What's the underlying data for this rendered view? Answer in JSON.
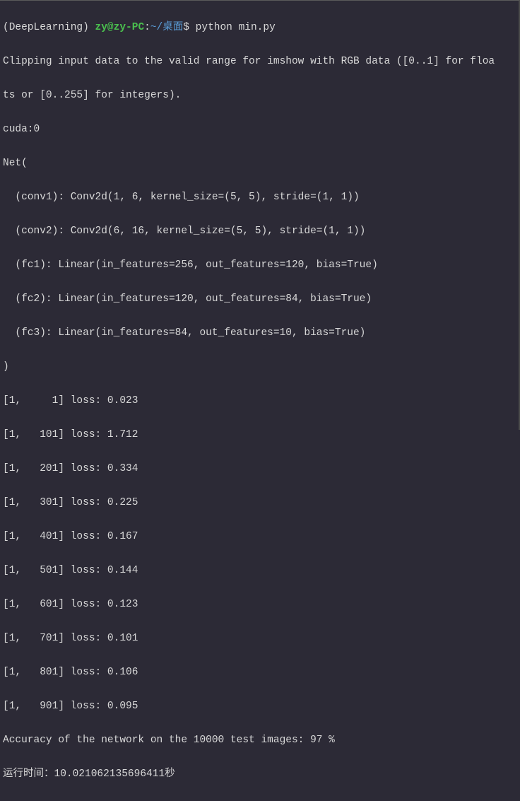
{
  "prompt": {
    "env": "(DeepLearning) ",
    "user": "zy@zy-PC",
    "colon": ":",
    "path_prefix": "~/",
    "path": "桌面",
    "dollar": "$ ",
    "command": "python min.py"
  },
  "output": {
    "line1": "Clipping input data to the valid range for imshow with RGB data ([0..1] for floa",
    "line2": "ts or [0..255] for integers).",
    "line3": "cuda:0",
    "line4": "Net(",
    "line5": "  (conv1): Conv2d(1, 6, kernel_size=(5, 5), stride=(1, 1))",
    "line6": "  (conv2): Conv2d(6, 16, kernel_size=(5, 5), stride=(1, 1))",
    "line7": "  (fc1): Linear(in_features=256, out_features=120, bias=True)",
    "line8": "  (fc2): Linear(in_features=120, out_features=84, bias=True)",
    "line9": "  (fc3): Linear(in_features=84, out_features=10, bias=True)",
    "line10": ")",
    "loss1": "[1,     1] loss: 0.023",
    "loss2": "[1,   101] loss: 1.712",
    "loss3": "[1,   201] loss: 0.334",
    "loss4": "[1,   301] loss: 0.225",
    "loss5": "[1,   401] loss: 0.167",
    "loss6": "[1,   501] loss: 0.144",
    "loss7": "[1,   601] loss: 0.123",
    "loss8": "[1,   701] loss: 0.101",
    "loss9": "[1,   801] loss: 0.106",
    "loss10": "[1,   901] loss: 0.095",
    "accuracy": "Accuracy of the network on the 10000 test images: 97 %",
    "runtime": "运行时间：10.021062135696411秒"
  }
}
